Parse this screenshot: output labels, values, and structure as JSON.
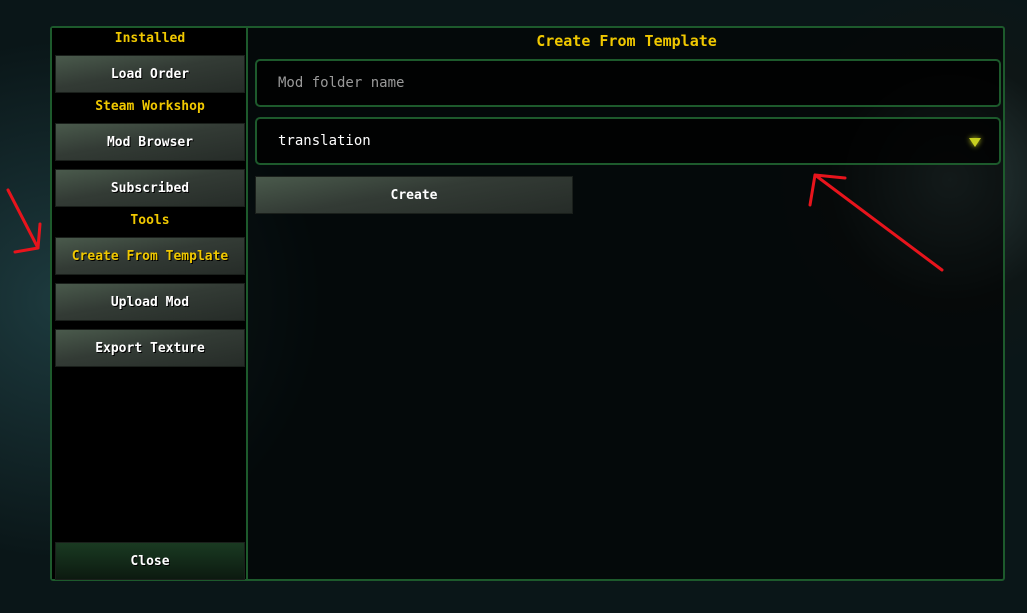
{
  "sidebar": {
    "installed_header": "Installed",
    "load_order": "Load Order",
    "workshop_header": "Steam Workshop",
    "mod_browser": "Mod Browser",
    "subscribed": "Subscribed",
    "tools_header": "Tools",
    "create_from_template": "Create From Template",
    "upload_mod": "Upload Mod",
    "export_texture": "Export Texture",
    "close": "Close"
  },
  "main": {
    "title": "Create From Template",
    "folder_placeholder": "Mod folder name",
    "template_value": "translation",
    "create_label": "Create"
  },
  "colors": {
    "accent": "#f0c800",
    "border": "#1d5a2c",
    "annotation": "#e8141c"
  }
}
